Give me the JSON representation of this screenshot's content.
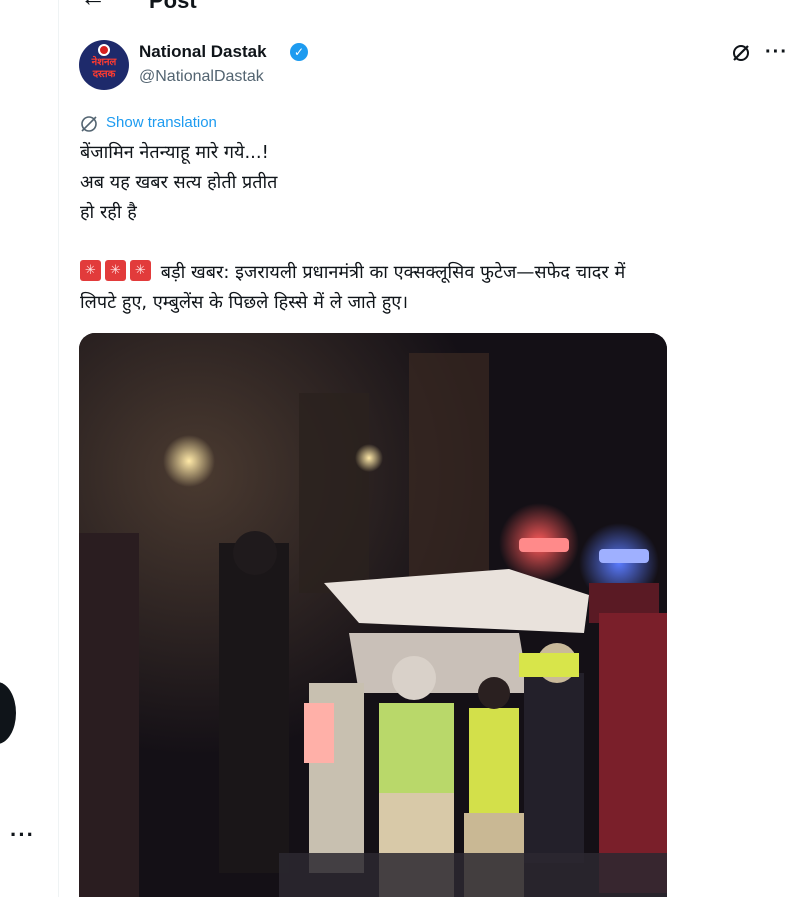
{
  "header": {
    "back_icon": "arrow-left-icon",
    "title": "Post"
  },
  "author": {
    "name": "National Dastak",
    "handle": "@NationalDastak",
    "verified": true,
    "avatar_text_line1": "नेशनल",
    "avatar_text_line2": "दस्तक"
  },
  "actions": {
    "grok_icon": "grok-icon",
    "more_icon": "more-horizontal-icon",
    "more_glyph": "···"
  },
  "translation": {
    "icon": "translate-icon",
    "label": "Show translation"
  },
  "post": {
    "line1": "बेंजामिन नेतन्याहू मारे गये...!",
    "line2": "अब यह खबर सत्य होती प्रतीत",
    "line3": "हो रही है",
    "line4": "बड़ी खबर: इजरायली प्रधानमंत्री का एक्सक्लूसिव फुटेज—सफेद चादर में",
    "line5": "लिपटे हुए, एम्बुलेंस के पिछले हिस्से में ले जाते हुए।",
    "siren_emoji_count": 3
  },
  "media": {
    "type": "video-still",
    "icon": "video-media"
  },
  "left_rail": {
    "more_glyph": "···"
  },
  "colors": {
    "accent": "#1d9bf0",
    "text": "#0f1419",
    "muted": "#536471",
    "siren": "#e23b3b"
  }
}
